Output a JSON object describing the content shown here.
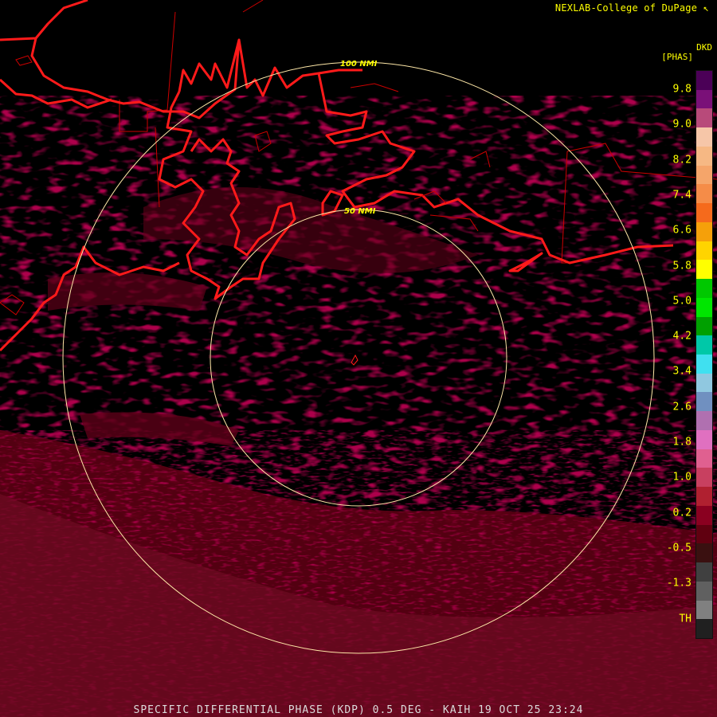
{
  "credit": "NEXLAB-College of DuPage",
  "units": {
    "line1": "DKD",
    "line2": "[PHAS]"
  },
  "range_rings": [
    {
      "label": "50 NMI",
      "range_nmi": 50
    },
    {
      "label": "100 NMI",
      "range_nmi": 100
    }
  ],
  "scale": {
    "labels": [
      "9.8",
      "9.0",
      "8.2",
      "7.4",
      "6.6",
      "5.8",
      "5.0",
      "4.2",
      "3.4",
      "2.6",
      "1.8",
      "1.0",
      "0.2",
      "-0.5",
      "-1.3",
      "TH"
    ],
    "colors": [
      "#4b0057",
      "#7a1078",
      "#b84a7a",
      "#f6c6a8",
      "#f6b884",
      "#f5a56a",
      "#f58c48",
      "#f56a1c",
      "#f5a00a",
      "#ffd400",
      "#ffff00",
      "#00c800",
      "#00e600",
      "#00a000",
      "#00c8a8",
      "#40e0f0",
      "#90c8e0",
      "#7090c0",
      "#b070b0",
      "#e070c0",
      "#e06090",
      "#c84060",
      "#b02030",
      "#8a0020",
      "#600010",
      "#3a1010",
      "#404040",
      "#606060",
      "#808080",
      "#202020"
    ]
  },
  "footer": {
    "product": "SPECIFIC DIFFERENTIAL PHASE (KDP)",
    "elevation": "0.5 DEG",
    "station": "KAIH",
    "datetime": "19 OCT 25 23:24"
  },
  "colors": {
    "coast": "#ff1a1a",
    "boundary": "#cc0000",
    "ring": "#ffe8a8",
    "echo": "#6a0018"
  }
}
